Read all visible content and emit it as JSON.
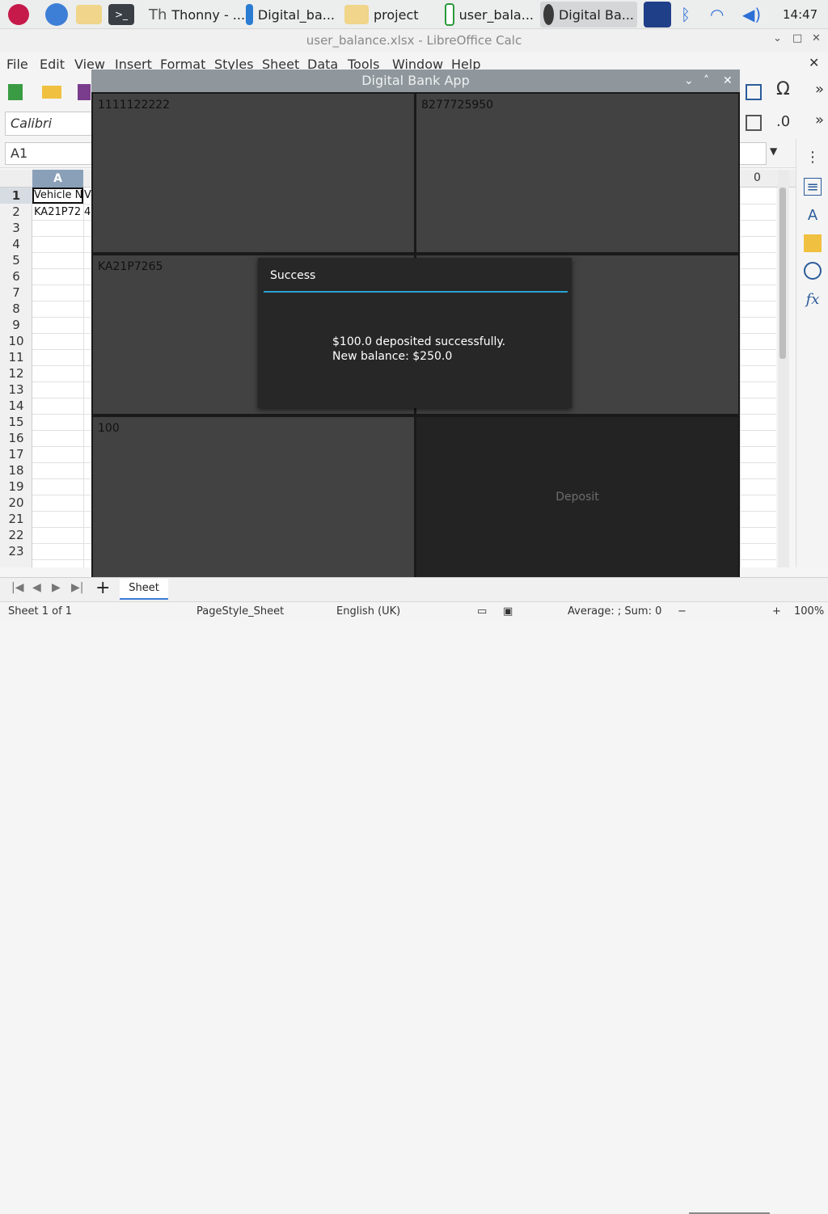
{
  "taskbar": {
    "apps": [
      {
        "label": "Thonny  - ..."
      },
      {
        "label": "Digital_ba..."
      },
      {
        "label": "project"
      },
      {
        "label": "user_bala..."
      },
      {
        "label": "Digital Ba..."
      }
    ],
    "clock": "14:47"
  },
  "calc": {
    "window_title": "user_balance.xlsx - LibreOffice Calc",
    "menu": [
      "File",
      "Edit",
      "View",
      "Insert",
      "Format",
      "Styles",
      "Sheet",
      "Data",
      "Tools",
      "Window",
      "Help"
    ],
    "font_name": "Calibri",
    "name_box": "A1",
    "column_a": "A",
    "column_o": "0",
    "rows": [
      "1",
      "2",
      "3",
      "4",
      "5",
      "6",
      "7",
      "8",
      "9",
      "10",
      "11",
      "12",
      "13",
      "14",
      "15",
      "16",
      "17",
      "18",
      "19",
      "20",
      "21",
      "22",
      "23"
    ],
    "cells": {
      "a1": "Vehicle N",
      "b1": "V",
      "a2": "KA21P72",
      "b2": "4"
    },
    "sheet_tab": "Sheet",
    "status": {
      "sheet": "Sheet 1 of 1",
      "page_style": "PageStyle_Sheet",
      "language": "English (UK)",
      "summary": "Average: ; Sum: 0",
      "zoom": "100%"
    }
  },
  "app": {
    "title": "Digital Bank App",
    "panels": {
      "top_left": "1111122222",
      "top_right": "8277725950",
      "middle_left": "KA21P7265",
      "bottom_left": "100",
      "deposit_button": "Deposit"
    },
    "popup": {
      "title": "Success",
      "line1": "$100.0 deposited successfully.",
      "line2": "New balance: $250.0"
    }
  }
}
